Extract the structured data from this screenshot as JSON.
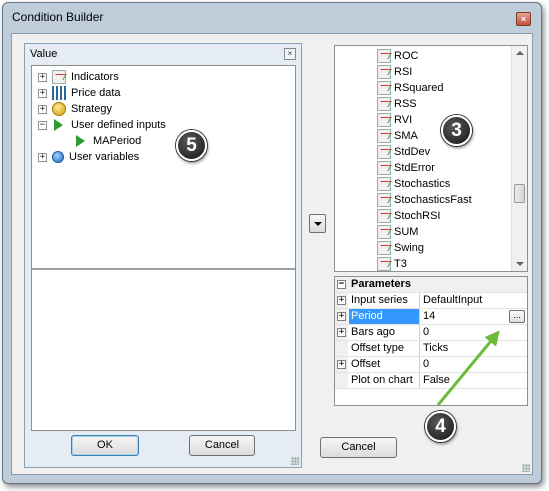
{
  "window": {
    "title": "Condition Builder",
    "close_glyph": "×"
  },
  "value_panel": {
    "title": "Value",
    "close_glyph": "×",
    "tree": [
      {
        "label": "Indicators",
        "icon": "indicator-icon",
        "expander": "+"
      },
      {
        "label": "Price data",
        "icon": "price-data-icon",
        "expander": "+"
      },
      {
        "label": "Strategy",
        "icon": "strategy-icon",
        "expander": "+"
      },
      {
        "label": "User defined inputs",
        "icon": "play-icon",
        "expander": "−"
      },
      {
        "label": "MAPeriod",
        "icon": "play-icon",
        "expander": ""
      },
      {
        "label": "User variables",
        "icon": "globe-icon",
        "expander": "+"
      }
    ],
    "ok_label": "OK",
    "cancel_label": "Cancel"
  },
  "indicator_list": {
    "items": [
      "ROC",
      "RSI",
      "RSquared",
      "RSS",
      "RVI",
      "SMA",
      "StdDev",
      "StdError",
      "Stochastics",
      "StochasticsFast",
      "StochRSI",
      "SUM",
      "Swing",
      "T3"
    ]
  },
  "parameters": {
    "category": "Parameters",
    "category_expander": "−",
    "rows": [
      {
        "name": "Input series",
        "value": "DefaultInput",
        "expander": "+"
      },
      {
        "name": "Period",
        "value": "14",
        "expander": "+"
      },
      {
        "name": "Bars ago",
        "value": "0",
        "expander": "+"
      },
      {
        "name": "Offset type",
        "value": "Ticks",
        "expander": ""
      },
      {
        "name": "Offset",
        "value": "0",
        "expander": "+"
      },
      {
        "name": "Plot on chart",
        "value": "False",
        "expander": ""
      }
    ],
    "ellipsis_label": "..."
  },
  "right_cancel_label": "Cancel",
  "callouts": {
    "five": "5",
    "three": "3",
    "four": "4"
  },
  "colors": {
    "selection": "#3399ff",
    "arrow": "#6dbb3a",
    "window_frame": "#bfcddb"
  }
}
